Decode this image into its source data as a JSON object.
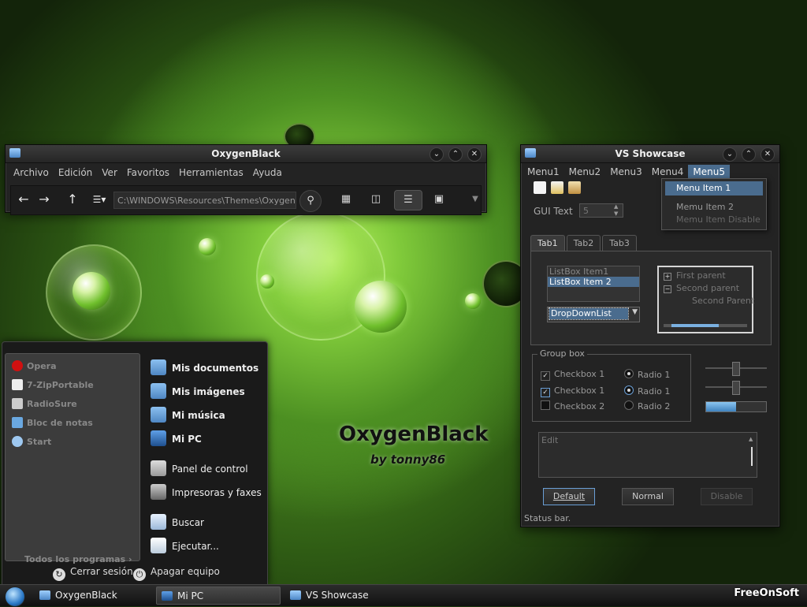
{
  "desktop": {
    "brand_title": "OxygenBlack",
    "brand_subtitle": "by tonny86"
  },
  "explorer": {
    "title": "OxygenBlack",
    "menu": [
      "Archivo",
      "Edición",
      "Ver",
      "Favoritos",
      "Herramientas",
      "Ayuda"
    ],
    "address": "C:\\WINDOWS\\Resources\\Themes\\OxygenBlack"
  },
  "vs_showcase": {
    "title": "VS Showcase",
    "menu": [
      "Menu1",
      "Menu2",
      "Menu3",
      "Menu4",
      "Menu5"
    ],
    "dropdown_items": [
      "Menu Item 1",
      "Memu Item 2",
      "Memu Item Disable"
    ],
    "gui_text_label": "GUI Text",
    "spin_value": "5",
    "tabs": [
      "Tab1",
      "Tab2",
      "Tab3"
    ],
    "listbox_items": [
      "ListBox Item1",
      "ListBox Item 2"
    ],
    "dropdownlist_value": "DropDownList",
    "tree": {
      "first": "First parent",
      "second": "Second parent",
      "child": "Second Parent"
    },
    "groupbox_title": "Group box",
    "checkboxes": [
      "Checkbox 1",
      "Checkbox 1",
      "Checkbox 2"
    ],
    "radios": [
      "Radio 1",
      "Radio 1",
      "Radio 2"
    ],
    "progress_fraction": 0.5,
    "edit_text": "Edit",
    "buttons": {
      "default": "Default",
      "normal": "Normal",
      "disable": "Disable"
    },
    "status": "Status bar."
  },
  "start_menu": {
    "pinned": [
      "Opera",
      "7-ZipPortable",
      "RadioSure",
      "Bloc de notas",
      "Start"
    ],
    "all_programs": "Todos los programas",
    "right": {
      "documents": "Mis documentos",
      "pictures": "Mis imágenes",
      "music": "Mi música",
      "computer": "Mi PC",
      "control_panel": "Panel de control",
      "printers": "Impresoras y faxes",
      "search": "Buscar",
      "run": "Ejecutar..."
    },
    "logoff": "Cerrar sesión",
    "shutdown": "Apagar equipo"
  },
  "taskbar": {
    "tasks": [
      "OxygenBlack",
      "Mi PC",
      "VS Showcase"
    ],
    "watermark": "FreeOnSoft"
  }
}
